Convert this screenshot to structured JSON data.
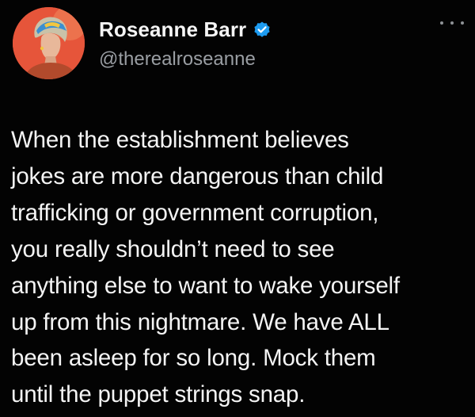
{
  "tweet": {
    "author": {
      "display_name": "Roseanne Barr",
      "handle": "@therealroseanne",
      "verified": true,
      "avatar_icon": "profile-photo-avatar",
      "verified_icon": "verified-badge-icon"
    },
    "menu_icon": "more-options-icon",
    "text_lines": [
      "When the establishment believes",
      "jokes are more dangerous than child",
      "trafficking or government corruption,",
      "you really shouldn’t need to see",
      "anything else to want to wake yourself",
      "up from this nightmare. We have ALL",
      "been asleep for so long. Mock them",
      "until the puppet strings snap."
    ]
  },
  "colors": {
    "background": "#030303",
    "text": "#f4f4f4",
    "handle": "#9a9ea3",
    "verified_badge": "#1d9bf0",
    "avatar_background": "#e6553a"
  }
}
